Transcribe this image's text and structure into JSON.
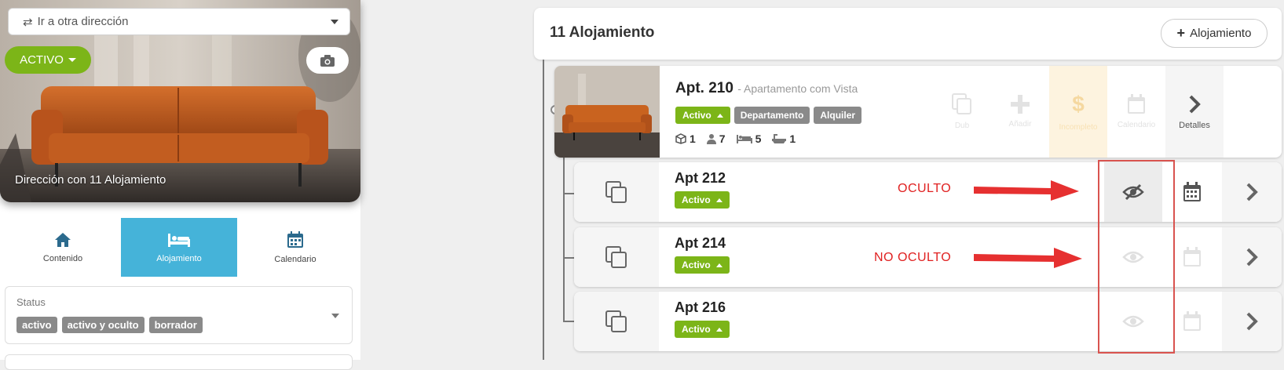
{
  "left_panel": {
    "address_select": {
      "label": "Ir a otra dirección"
    },
    "status_button": {
      "label": "ACTIVO"
    },
    "hero_caption": "Dirección con 11 Alojamiento",
    "tabs": [
      {
        "label": "Contenido",
        "icon": "home-icon",
        "active": false
      },
      {
        "label": "Alojamiento",
        "icon": "bed-icon",
        "active": true
      },
      {
        "label": "Calendario",
        "icon": "calendar-icon",
        "active": false
      }
    ],
    "status_filter": {
      "label": "Status",
      "chips": [
        "activo",
        "activo y oculto",
        "borrador"
      ]
    }
  },
  "main": {
    "header": {
      "title": "11 Alojamiento",
      "add_button": "Alojamiento"
    },
    "parent_listing": {
      "title": "Apt. 210",
      "subtitle": "- Apartamento com Vista",
      "status": "Activo",
      "tags": [
        "Departamento",
        "Alquiler"
      ],
      "meta": {
        "units": "1",
        "guests": "7",
        "beds": "5",
        "baths": "1"
      },
      "actions": [
        "Dub",
        "Añadir",
        "Incompleto",
        "Calendario",
        "Detalles"
      ]
    },
    "sub_listings": [
      {
        "title": "Apt 212",
        "status": "Activo",
        "hidden": true
      },
      {
        "title": "Apt 214",
        "status": "Activo",
        "hidden": false
      },
      {
        "title": "Apt 216",
        "status": "Activo",
        "hidden": false
      }
    ]
  },
  "annotations": {
    "oculto": "OCULTO",
    "no_oculto": "NO OCULTO"
  },
  "colors": {
    "green": "#7cb518",
    "tab_active": "#45b3d9",
    "annotation_red": "#e02020",
    "incomplete_bg": "#fdf3df"
  }
}
